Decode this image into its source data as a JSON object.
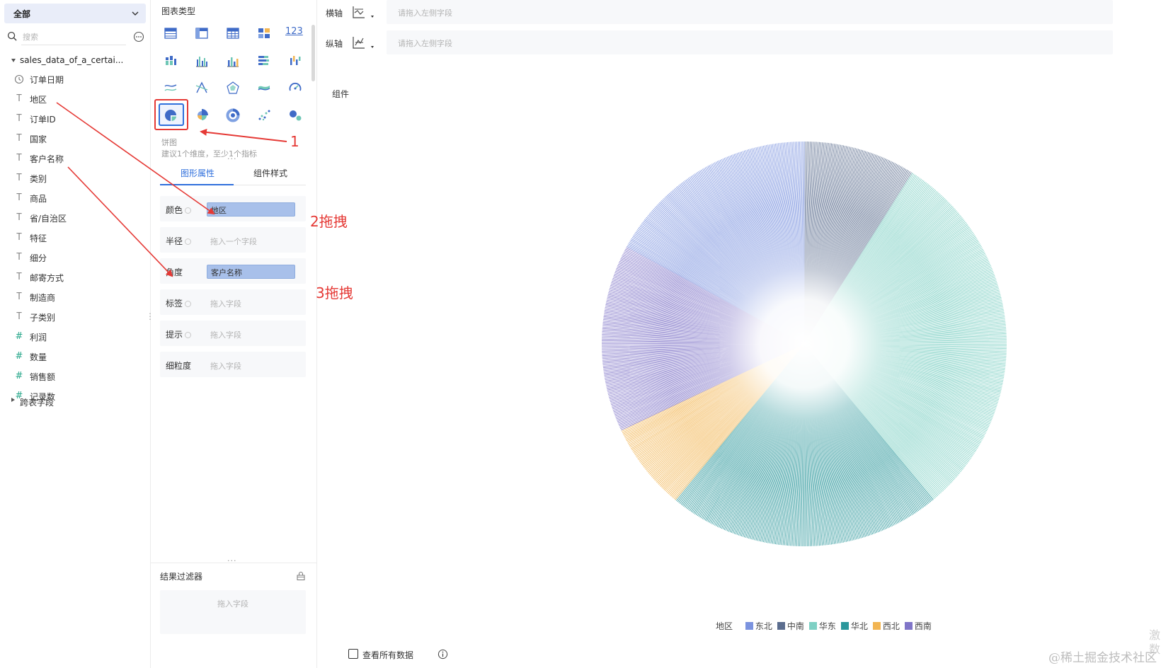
{
  "left_panel": {
    "scope_select": "全部",
    "search_placeholder": "搜索",
    "dataset_name": "sales_data_of_a_certai...",
    "fields": [
      {
        "label": "订单日期",
        "kind": "date"
      },
      {
        "label": "地区",
        "kind": "text"
      },
      {
        "label": "订单ID",
        "kind": "text"
      },
      {
        "label": "国家",
        "kind": "text"
      },
      {
        "label": "客户名称",
        "kind": "text"
      },
      {
        "label": "类别",
        "kind": "text"
      },
      {
        "label": "商品",
        "kind": "text"
      },
      {
        "label": "省/自治区",
        "kind": "text"
      },
      {
        "label": "特征",
        "kind": "text"
      },
      {
        "label": "细分",
        "kind": "text"
      },
      {
        "label": "邮寄方式",
        "kind": "text"
      },
      {
        "label": "制造商",
        "kind": "text"
      },
      {
        "label": "子类别",
        "kind": "text"
      },
      {
        "label": "利润",
        "kind": "number"
      },
      {
        "label": "数量",
        "kind": "number"
      },
      {
        "label": "销售额",
        "kind": "number"
      },
      {
        "label": "记录数",
        "kind": "number-count"
      }
    ],
    "cross_table": "跨表字段"
  },
  "mid_panel": {
    "chart_type_title": "图表类型",
    "chart_type_icons": [
      "table-icon",
      "pivot-table-icon",
      "detail-table-icon",
      "indicator-card-icon",
      "number-card-icon",
      "stacked-bar-icon",
      "grouped-bar-icon",
      "bar-chart-icon",
      "horizontal-bar-icon",
      "column-chart-icon",
      "line-chart-icon",
      "cross-line-icon",
      "radar-chart-icon",
      "area-chart-icon",
      "gauge-icon",
      "pie-chart-icon",
      "rose-chart-icon",
      "ring-chart-icon",
      "scatter-chart-icon",
      "bubble-chart-icon"
    ],
    "number_icon_text": "123",
    "selected_chart_name": "饼图",
    "selected_chart_hint": "建议1个维度，至少1个指标",
    "tabs": {
      "props": "图形属性",
      "style": "组件样式"
    },
    "props": [
      {
        "label": "颜色",
        "value": "地区",
        "placeholder": ""
      },
      {
        "label": "半径",
        "value": "",
        "placeholder": "拖入一个字段"
      },
      {
        "label": "角度",
        "value": "客户名称",
        "placeholder": ""
      },
      {
        "label": "标签",
        "value": "",
        "placeholder": "拖入字段"
      },
      {
        "label": "提示",
        "value": "",
        "placeholder": "拖入字段"
      },
      {
        "label": "细粒度",
        "value": "",
        "placeholder": "拖入字段"
      }
    ],
    "result_filter": {
      "title": "结果过滤器",
      "placeholder": "拖入字段"
    }
  },
  "canvas": {
    "x_axis": {
      "label": "横轴",
      "placeholder": "请拖入左侧字段"
    },
    "y_axis": {
      "label": "纵轴",
      "placeholder": "请拖入左侧字段"
    },
    "widget_label": "组件",
    "view_all_data": "查看所有数据",
    "watermark": "@稀土掘金技术社区",
    "edge_glyphs": [
      "激",
      "数"
    ]
  },
  "annotations": {
    "step1": "1",
    "step2": "2拖拽",
    "step3": "3拖拽"
  },
  "colors": {
    "accent": "#2f6fdc",
    "annotation_red": "#e53935",
    "pill_blue": "#a8c0ea"
  },
  "chart_data": {
    "type": "pie",
    "legend_title": "地区",
    "legend_position": "bottom-center",
    "series": [
      {
        "name": "东北",
        "color": "#7b93df",
        "share": 0.17
      },
      {
        "name": "中南",
        "color": "#5b6d8e",
        "share": 0.09
      },
      {
        "name": "华东",
        "color": "#7ed0c4",
        "share": 0.3
      },
      {
        "name": "华北",
        "color": "#2b979b",
        "share": 0.22
      },
      {
        "name": "西北",
        "color": "#f2b552",
        "share": 0.07
      },
      {
        "name": "西南",
        "color": "#8075c8",
        "share": 0.15
      }
    ],
    "slice_order": [
      "中南",
      "华东",
      "华北",
      "西北",
      "西南",
      "东北"
    ],
    "thin_slice_lines": true
  }
}
